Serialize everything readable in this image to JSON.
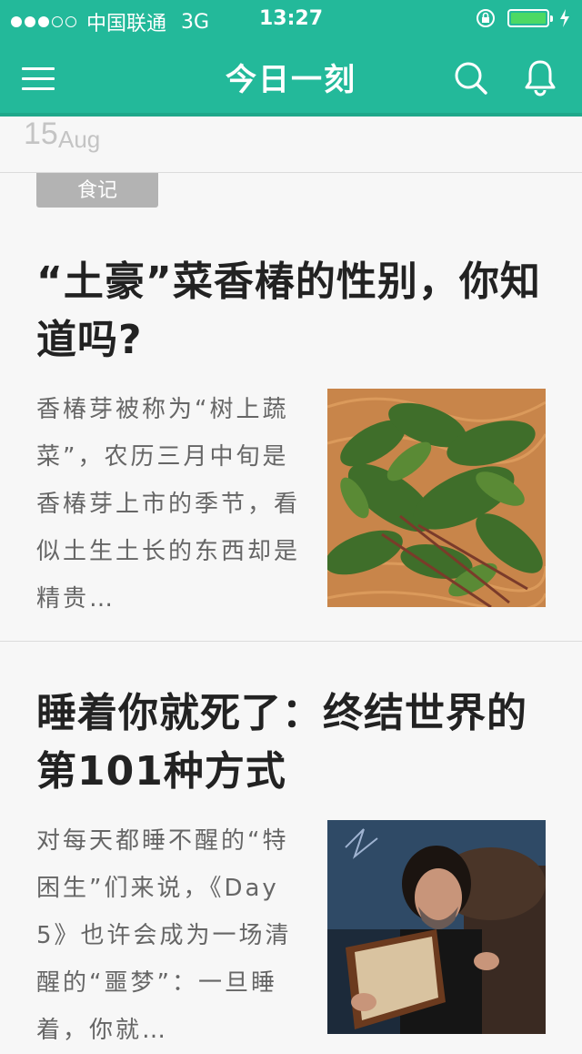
{
  "status_bar": {
    "carrier": "中国联通",
    "network": "3G",
    "time": "13:27"
  },
  "nav": {
    "title": "今日一刻"
  },
  "date": {
    "day": "15",
    "month": "Aug"
  },
  "articles": [
    {
      "tag": "食记",
      "title": "“土豪”菜香椿的性别，你知道吗?",
      "summary": "香椿芽被称为“树上蔬菜”，农历三月中旬是香椿芽上市的季节，看似土生土长的东西却是精贵…"
    },
    {
      "title": "睡着你就死了：终结世界的第101种方式",
      "summary": "对每天都睡不醒的“特困生”们来说，《Day 5》也许会成为一场清醒的“噩梦”：一旦睡着，你就…"
    }
  ],
  "colors": {
    "accent": "#23b99a",
    "battery": "#4cd964",
    "tag_bg": "#b3b3b3"
  },
  "icons": [
    "menu-icon",
    "search-icon",
    "bell-icon",
    "lock-rotation-icon",
    "battery-icon",
    "charging-icon"
  ]
}
